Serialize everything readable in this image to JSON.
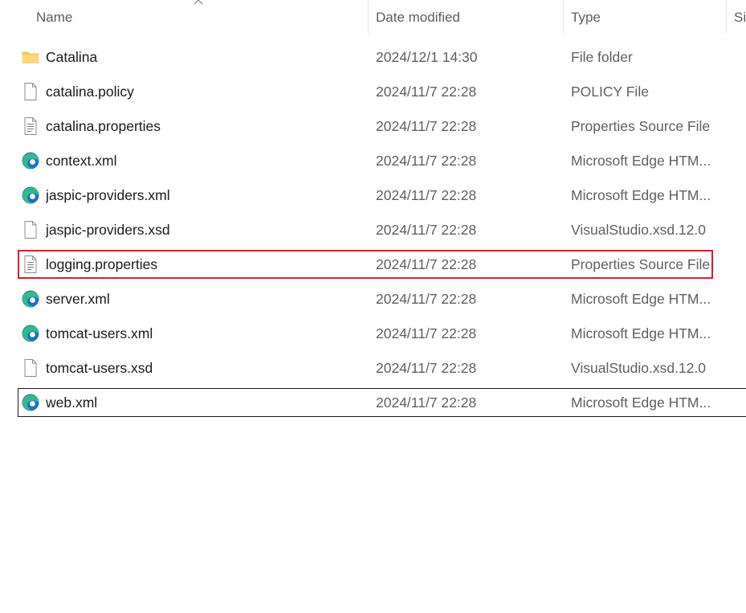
{
  "columns": {
    "name": "Name",
    "date": "Date modified",
    "type": "Type",
    "size": "Si"
  },
  "files": [
    {
      "name": "Catalina",
      "date": "2024/12/1 14:30",
      "type": "File folder",
      "icon": "folder-icon"
    },
    {
      "name": "catalina.policy",
      "date": "2024/11/7 22:28",
      "type": "POLICY File",
      "icon": "file-icon"
    },
    {
      "name": "catalina.properties",
      "date": "2024/11/7 22:28",
      "type": "Properties Source File",
      "icon": "text-file-icon"
    },
    {
      "name": "context.xml",
      "date": "2024/11/7 22:28",
      "type": "Microsoft Edge HTM...",
      "icon": "edge-icon"
    },
    {
      "name": "jaspic-providers.xml",
      "date": "2024/11/7 22:28",
      "type": "Microsoft Edge HTM...",
      "icon": "edge-icon"
    },
    {
      "name": "jaspic-providers.xsd",
      "date": "2024/11/7 22:28",
      "type": "VisualStudio.xsd.12.0",
      "icon": "file-icon"
    },
    {
      "name": "logging.properties",
      "date": "2024/11/7 22:28",
      "type": "Properties Source File",
      "icon": "text-file-icon"
    },
    {
      "name": "server.xml",
      "date": "2024/11/7 22:28",
      "type": "Microsoft Edge HTM...",
      "icon": "edge-icon"
    },
    {
      "name": "tomcat-users.xml",
      "date": "2024/11/7 22:28",
      "type": "Microsoft Edge HTM...",
      "icon": "edge-icon"
    },
    {
      "name": "tomcat-users.xsd",
      "date": "2024/11/7 22:28",
      "type": "VisualStudio.xsd.12.0",
      "icon": "file-icon"
    },
    {
      "name": "web.xml",
      "date": "2024/11/7 22:28",
      "type": "Microsoft Edge HTM...",
      "icon": "edge-icon"
    }
  ],
  "colors": {
    "highlight_outline": "#d4202a",
    "focus_outline": "#1a1a1a",
    "folder": "#f4c65a",
    "edge_blue": "#1f6fc5",
    "edge_green": "#35b98a"
  }
}
